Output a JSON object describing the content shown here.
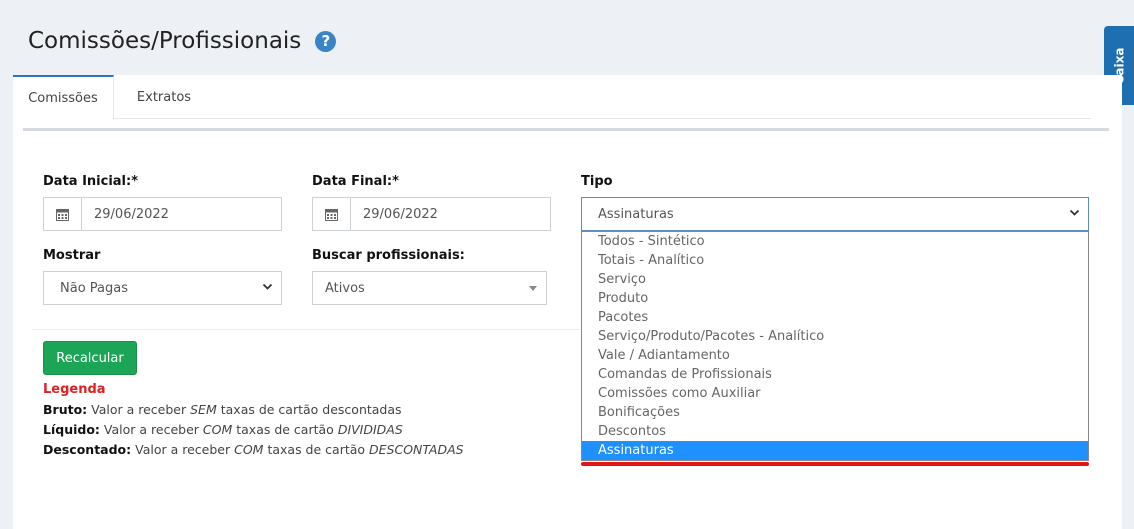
{
  "page": {
    "title": "Comissões/Profissionais",
    "help_icon": "question-circle-icon"
  },
  "side_tab": {
    "label": "Caixa"
  },
  "tabs": [
    {
      "label": "Comissões",
      "active": true
    },
    {
      "label": "Extratos",
      "active": false
    }
  ],
  "form": {
    "data_inicial": {
      "label": "Data Inicial:*",
      "value": "29/06/2022",
      "icon": "calendar-icon"
    },
    "data_final": {
      "label": "Data Final:*",
      "value": "29/06/2022",
      "icon": "calendar-icon"
    },
    "tipo": {
      "label": "Tipo",
      "value": "Assinaturas",
      "options": [
        "Todos - Sintético",
        "Totais - Analítico",
        "Serviço",
        "Produto",
        "Pacotes",
        "Serviço/Produto/Pacotes - Analítico",
        "Vale / Adiantamento",
        "Comandas de Profissionais",
        "Comissões como Auxiliar",
        "Bonificações",
        "Descontos",
        "Assinaturas"
      ],
      "selected_index": 11
    },
    "mostrar": {
      "label": "Mostrar",
      "value": "Não Pagas"
    },
    "buscar": {
      "label": "Buscar profissionais:",
      "value": "Ativos"
    },
    "recalcular_label": "Recalcular"
  },
  "legend": {
    "title": "Legenda",
    "bruto": {
      "term": "Bruto:",
      "pre": "Valor a receber",
      "em": "SEM",
      "post": "taxas de cartão descontadas"
    },
    "liquido": {
      "term": "Líquido:",
      "pre": "Valor a receber",
      "em": "COM",
      "mid": "taxas de cartão",
      "em2": "DIVIDIDAS"
    },
    "descontado": {
      "term": "Descontado:",
      "pre": "Valor a receber",
      "em": "COM",
      "mid": "taxas de cartão",
      "em2": "DESCONTADAS"
    }
  },
  "colors": {
    "accent": "#1e90ff",
    "button": "#1ca556",
    "legend_title": "#e02020",
    "underline": "#e01515"
  }
}
